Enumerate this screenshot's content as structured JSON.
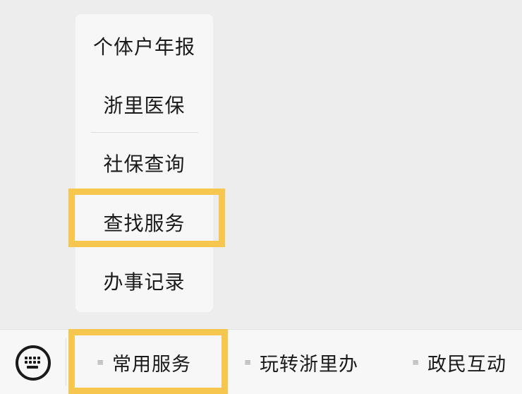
{
  "menu": {
    "items": [
      {
        "label": "个体户年报"
      },
      {
        "label": "浙里医保"
      },
      {
        "label": "社保查询"
      },
      {
        "label": "查找服务"
      },
      {
        "label": "办事记录"
      }
    ]
  },
  "bottom_bar": {
    "keyboard_icon": "keyboard-icon",
    "tabs": [
      {
        "label": "常用服务",
        "icon": "menu-lines-icon"
      },
      {
        "label": "玩转浙里办",
        "icon": "menu-lines-icon"
      },
      {
        "label": "政民互动",
        "icon": "menu-lines-icon"
      }
    ]
  },
  "colors": {
    "highlight": "#f7c64f",
    "background": "#ededed",
    "panel": "#f7f7f7",
    "text": "#1a1a1a"
  }
}
